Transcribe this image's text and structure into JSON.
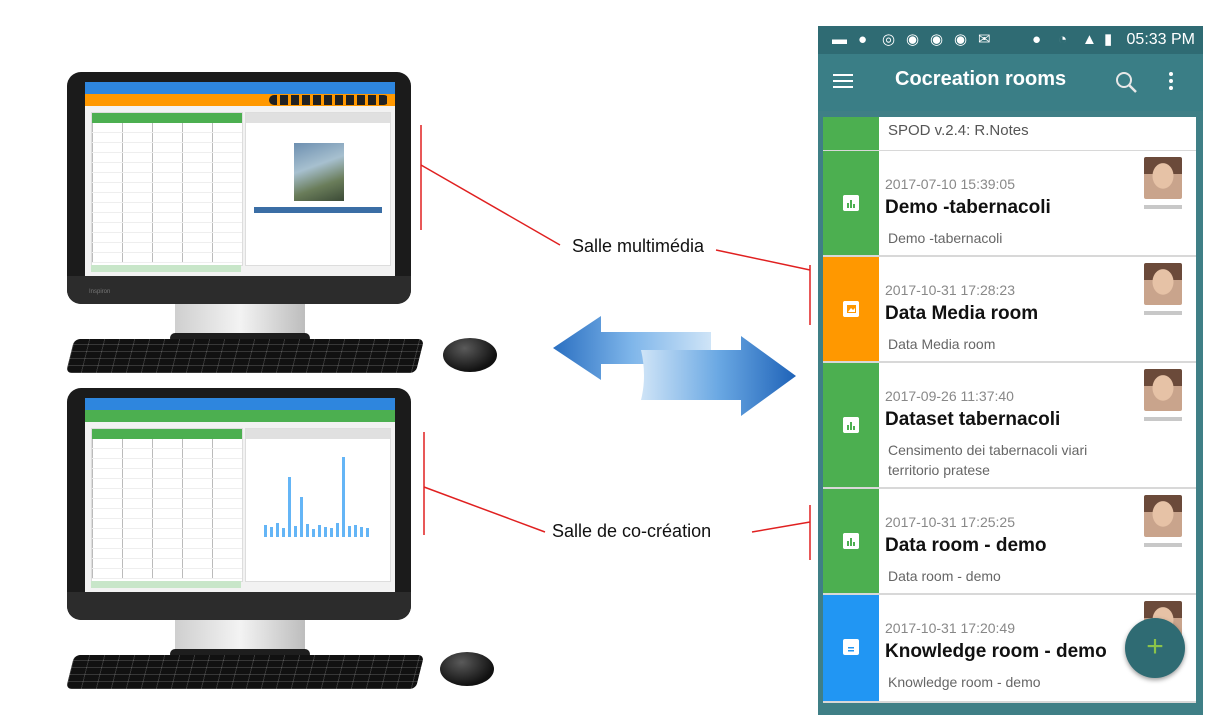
{
  "labels": {
    "multimedia": "Salle multimédia",
    "cocreation": "Salle de co-création"
  },
  "phone": {
    "status_bar": {
      "time": "05:33 PM",
      "icons": [
        "messenger-icon",
        "chat-icon",
        "sync-icon",
        "pinterest-icon",
        "pinterest-icon",
        "pinterest-icon",
        "mail-icon",
        "location-icon",
        "wifi-icon",
        "signal-icon",
        "battery-icon"
      ]
    },
    "app_bar": {
      "title": "Cocreation rooms",
      "icons": [
        "menu-icon",
        "search-icon",
        "more-vert-icon"
      ]
    },
    "rooms": [
      {
        "title": "SPOD v.2.4: R.Notes",
        "color": "#4caf50"
      },
      {
        "date": "2017-07-10 15:39:05",
        "title": "Demo -tabernacoli",
        "description": "Demo -tabernacoli",
        "color": "#4caf50",
        "icon": "chart-icon"
      },
      {
        "date": "2017-10-31 17:28:23",
        "title": "Data Media room",
        "description": "Data Media room",
        "color": "#ff9800",
        "icon": "image-icon"
      },
      {
        "date": "2017-09-26 11:37:40",
        "title": "Dataset tabernacoli",
        "description": "Censimento dei tabernacoli viari territorio pratese",
        "color": "#4caf50",
        "icon": "chart-icon"
      },
      {
        "date": "2017-10-31 17:25:25",
        "title": "Data room - demo",
        "description": "Data room - demo",
        "color": "#4caf50",
        "icon": "chart-icon"
      },
      {
        "date": "2017-10-31 17:20:49",
        "title": "Knowledge room - demo",
        "description": "Knowledge room - demo",
        "color": "#2196f3",
        "icon": "document-icon"
      }
    ],
    "fab_label": "+"
  },
  "monitors": {
    "top_screen": {
      "brand": "Inspiron"
    },
    "bottom_screen": {
      "brand": ""
    }
  }
}
